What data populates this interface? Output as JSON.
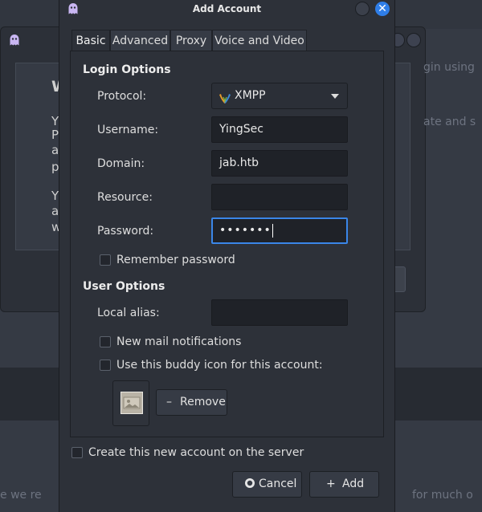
{
  "dialog": {
    "title": "Add Account",
    "tabs": [
      {
        "label": "Basic"
      },
      {
        "label": "Advanced"
      },
      {
        "label": "Proxy"
      },
      {
        "label": "Voice and Video"
      }
    ],
    "active_tab": "Basic"
  },
  "login_options": {
    "heading": "Login Options",
    "protocol_label": "Protocol:",
    "protocol_value": "XMPP",
    "username_label": "Username:",
    "username_value": "YingSec",
    "domain_label": "Domain:",
    "domain_value": "jab.htb",
    "resource_label": "Resource:",
    "resource_value": "",
    "password_label": "Password:",
    "password_masked": "•••••••",
    "remember_label": "Remember password",
    "remember_checked": false
  },
  "user_options": {
    "heading": "User Options",
    "alias_label": "Local alias:",
    "alias_value": "",
    "mail_label": "New mail notifications",
    "mail_checked": false,
    "buddy_icon_label": "Use this buddy icon for this account:",
    "buddy_icon_checked": false,
    "remove_label": "Remove"
  },
  "footer": {
    "create_label": "Create this new account on the server",
    "create_checked": false,
    "cancel_label": "Cancel",
    "add_label": "Add"
  },
  "background": {
    "texts": [
      "W",
      "Y",
      "P",
      "a",
      "p",
      "Y",
      "a",
      "w",
      "gin using",
      "ate and s",
      "e we re",
      "for much o"
    ]
  },
  "colors": {
    "accent": "#3a86e8",
    "close_button": "#2f7ee8",
    "dialog_bg": "#2d3139",
    "field_bg": "#1f2228"
  },
  "icons": {
    "title": "pidgin-icon",
    "protocol": "xmpp-icon",
    "cancel": "cancel-icon",
    "add": "plus-icon",
    "remove": "minus-icon"
  }
}
